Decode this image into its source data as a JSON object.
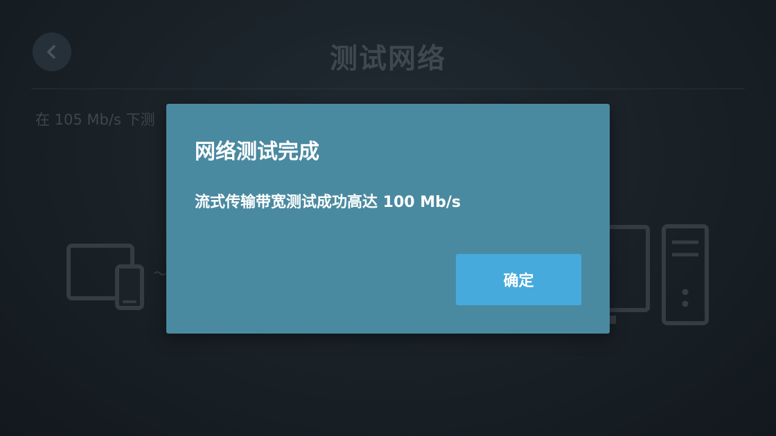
{
  "header": {
    "title": "测试网络",
    "back_icon": "chevron-left-icon"
  },
  "main": {
    "subtitle": "在 105 Mb/s 下测"
  },
  "dialog": {
    "title": "网络测试完成",
    "message": "流式传输带宽测试成功高达 100 Mb/s",
    "confirm_label": "确定"
  },
  "icons": {
    "left_device": "tablet-phone-icon",
    "right_device": "desktop-pc-icon"
  },
  "colors": {
    "dialog_background": "#4a8aa0",
    "confirm_button": "#46aadc",
    "page_background": "#222b33"
  }
}
